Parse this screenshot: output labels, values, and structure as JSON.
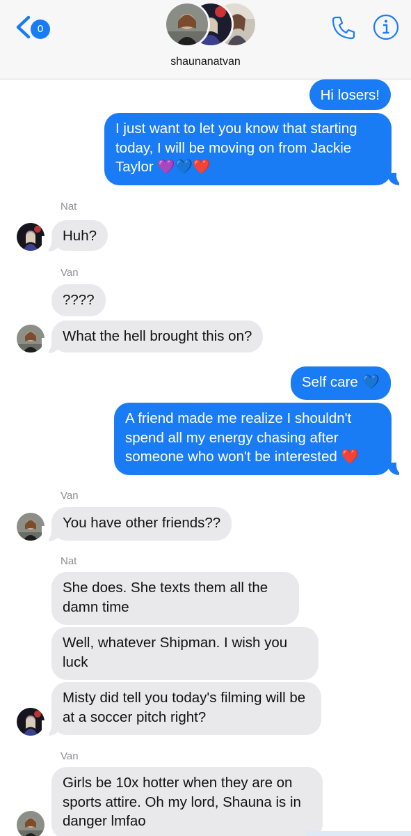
{
  "header": {
    "back_count": "0",
    "chat_name": "shaunanatvan",
    "icons": [
      "chevron-left-icon",
      "phone-icon",
      "info-icon"
    ],
    "accent_color": "#1a7cf5"
  },
  "messages": [
    {
      "side": "out",
      "text": "Hi losers!"
    },
    {
      "side": "out",
      "text": "I just want to let you know that starting today, I will be moving on from Jackie Taylor 💜💙❤️"
    },
    {
      "side": "in",
      "sender": "Nat",
      "text": "Huh?"
    },
    {
      "side": "in",
      "sender": "Van",
      "text": "????"
    },
    {
      "side": "in",
      "text": "What the hell brought this on?"
    },
    {
      "side": "out",
      "text": "Self care 💙"
    },
    {
      "side": "out",
      "text": "A friend made me realize I shouldn't spend all my energy chasing after someone who won't be interested ❤️"
    },
    {
      "side": "in",
      "sender": "Van",
      "text": "You have other friends??"
    },
    {
      "side": "in",
      "sender": "Nat",
      "text": "She does. She texts them all the damn time"
    },
    {
      "side": "in",
      "text": "Well, whatever Shipman. I wish you luck"
    },
    {
      "side": "in",
      "text": "Misty did tell you today's filming will be at a soccer pitch right?"
    },
    {
      "side": "in",
      "sender": "Van",
      "text": "Girls be 10x hotter when they are on sports attire. Oh my lord, Shauna is in danger lmfao"
    }
  ]
}
